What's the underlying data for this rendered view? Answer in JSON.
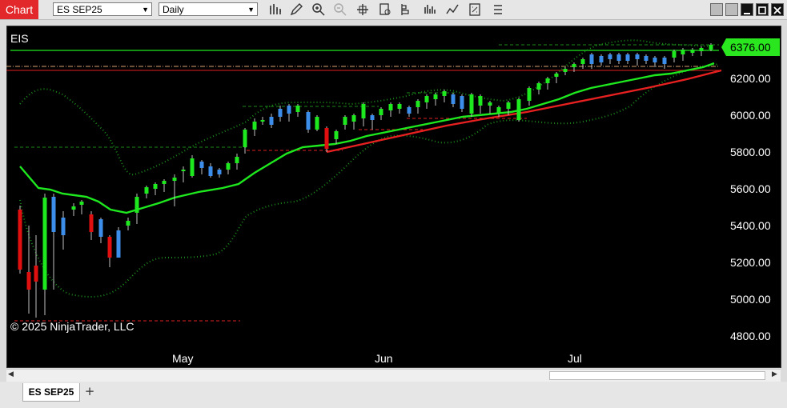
{
  "toolbar": {
    "app_title": "Chart",
    "instrument": "ES SEP25",
    "interval": "Daily",
    "tools": [
      "bar-type-icon",
      "drawing-tool-icon",
      "zoom-in-icon",
      "zoom-out-icon",
      "crosshair-icon",
      "data-box-icon",
      "indicators-icon",
      "strategies-icon",
      "properties-icon",
      "templates-icon",
      "more-icon"
    ]
  },
  "window_buttons": [
    "restore",
    "minimize",
    "maximize",
    "close"
  ],
  "chart": {
    "instrument_label": "EIS",
    "last_price": "6376.00",
    "last_price_color": "#29e61f",
    "copyright": "© 2025 NinjaTrader, LLC",
    "price_axis": [
      "6200.00",
      "6000.00",
      "5800.00",
      "5600.00",
      "5400.00",
      "5200.00",
      "5000.00",
      "4800.00"
    ],
    "time_axis": [
      "May",
      "Jun",
      "Jul"
    ],
    "colors": {
      "background": "#000000",
      "up_candle": "#1ee81e",
      "down_candle": "#e01010",
      "neutral_candle": "#3c8eea",
      "ma_fast": "#1ee81e",
      "ma_slow": "#e82020",
      "bands": "#1a8a1a"
    }
  },
  "tabs": [
    {
      "label": "ES SEP25"
    }
  ],
  "add_tab_label": "+"
}
